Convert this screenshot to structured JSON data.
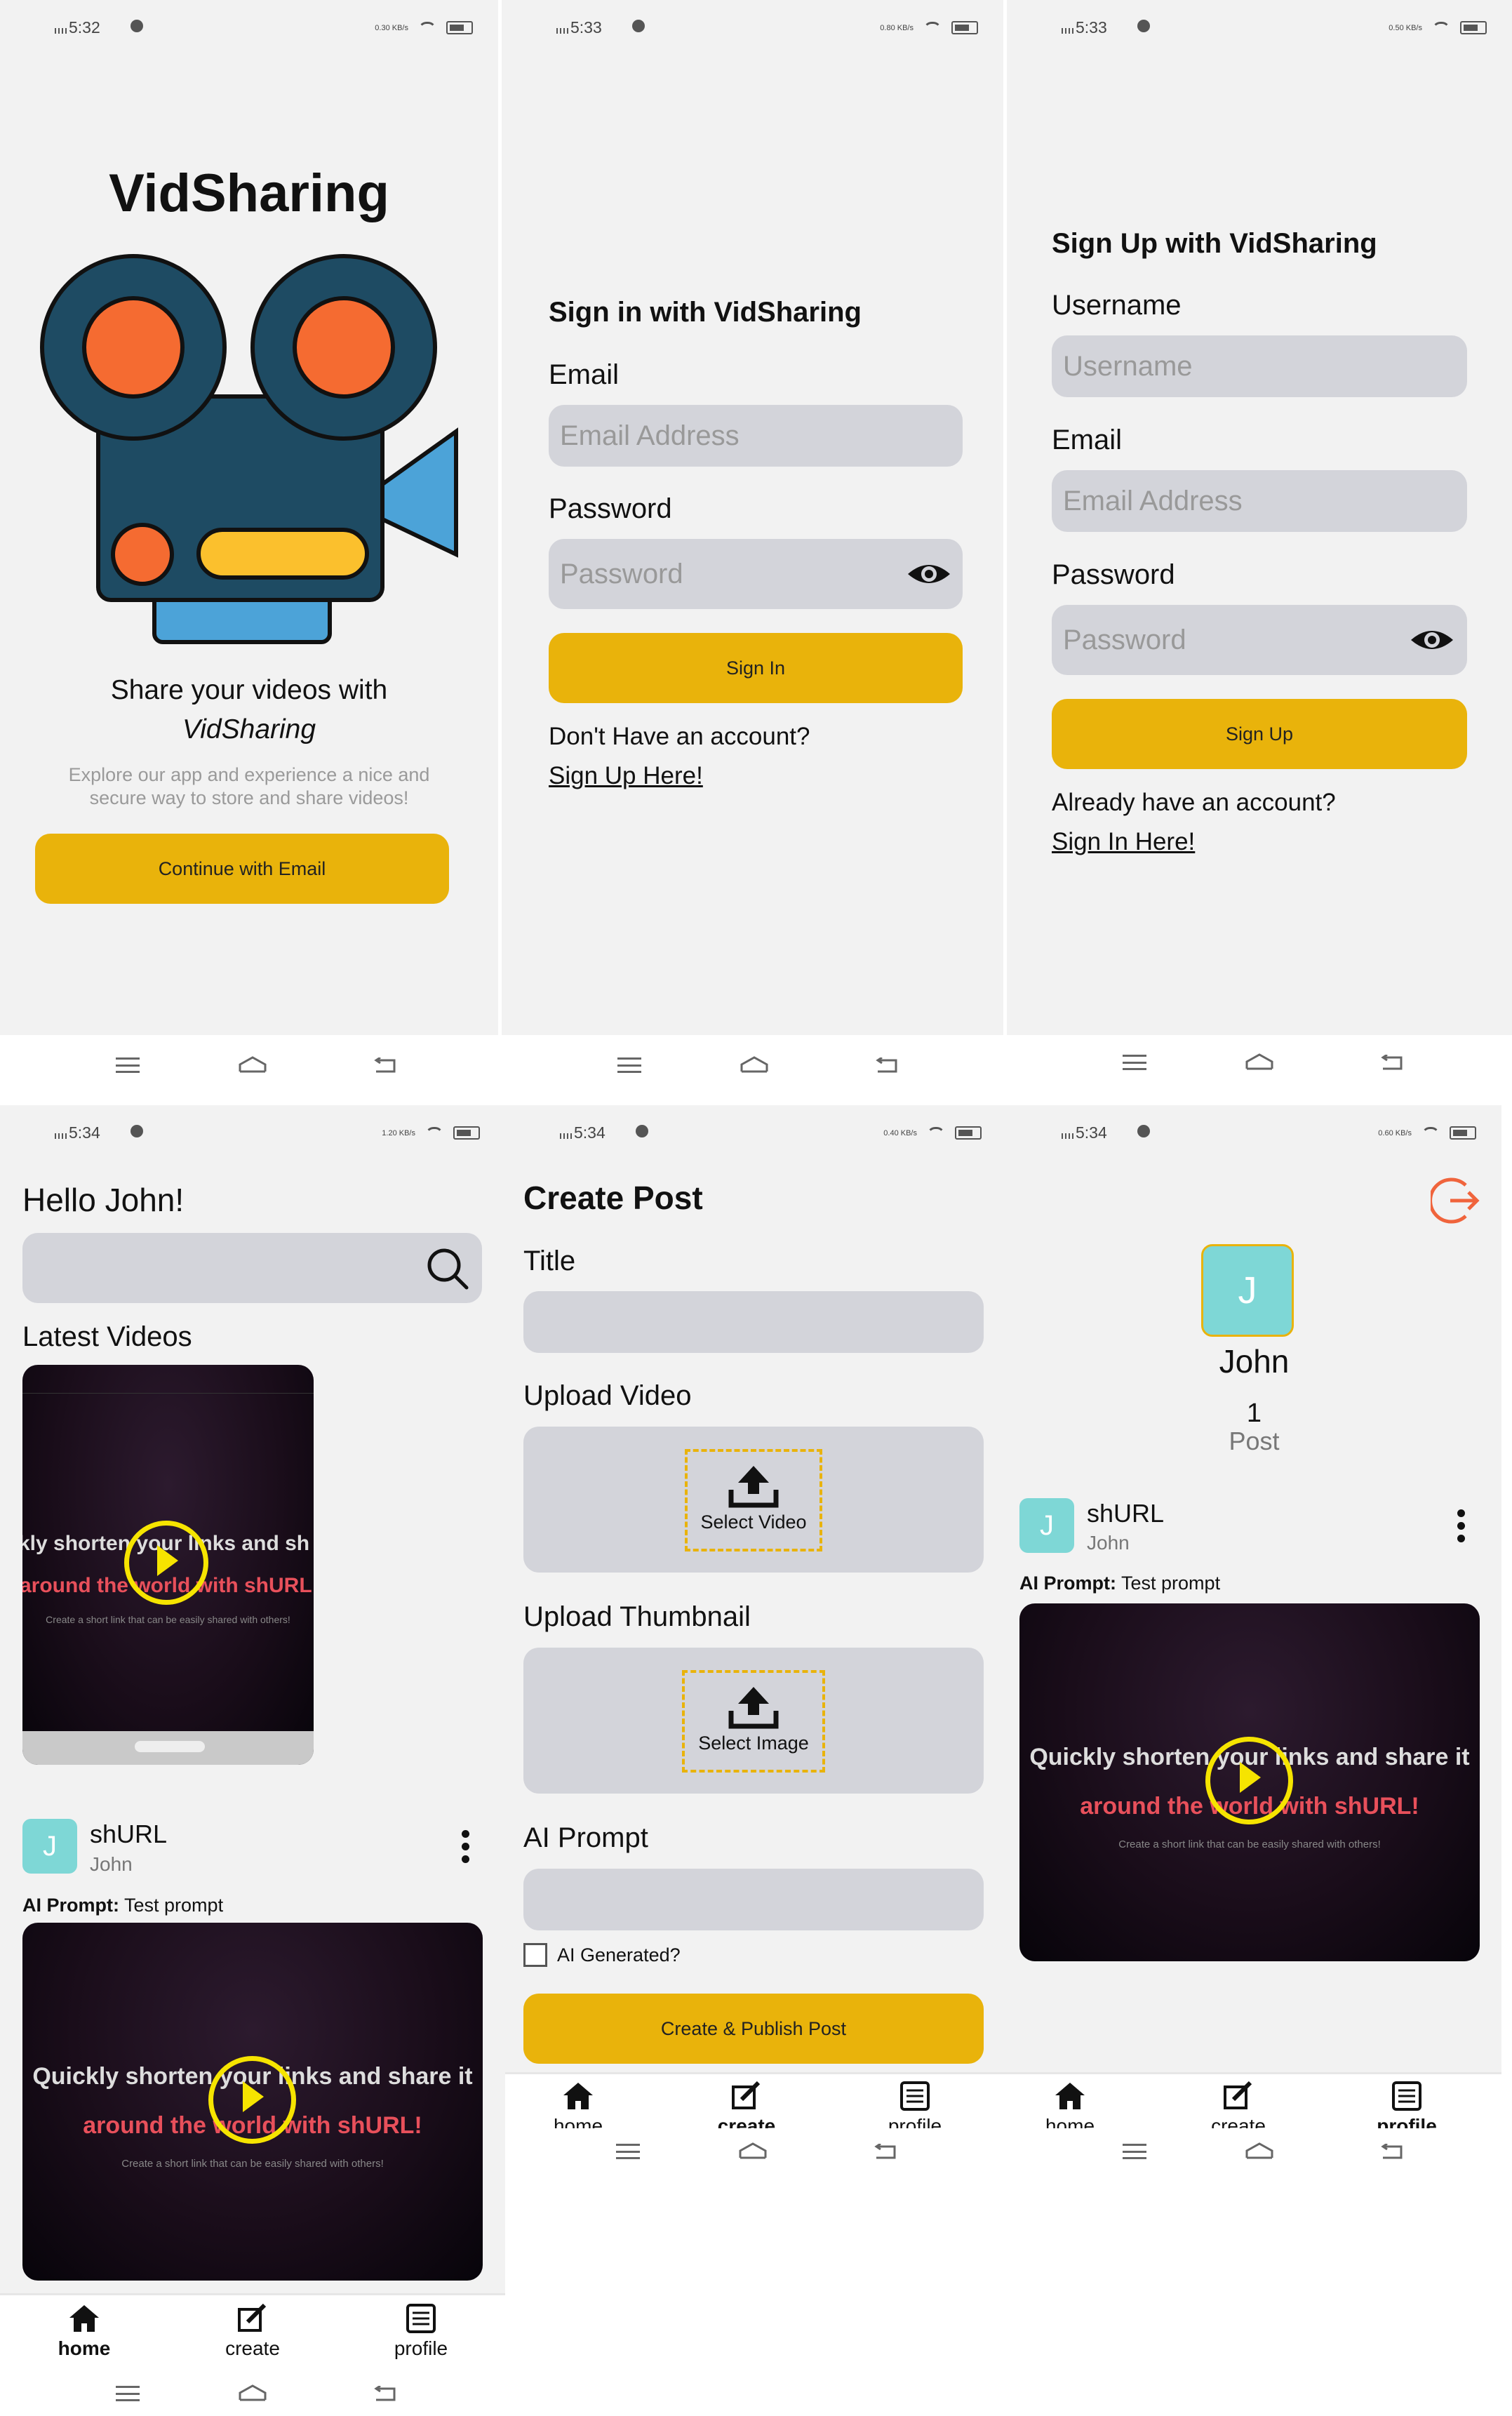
{
  "status": {
    "s1": {
      "time": "5:32",
      "speed": "0.30 KB/s"
    },
    "s2": {
      "time": "5:33",
      "speed": "0.80 KB/s"
    },
    "s3": {
      "time": "5:33",
      "speed": "0.50 KB/s"
    },
    "s4": {
      "time": "5:34",
      "speed": "1.20 KB/s"
    },
    "s5": {
      "time": "5:34",
      "speed": "0.40 KB/s"
    },
    "s6": {
      "time": "5:34",
      "speed": "0.60 KB/s"
    }
  },
  "welcome": {
    "app_title": "VidSharing",
    "tagline_1": "Share your videos with",
    "tagline_2": "VidSharing",
    "description": "Explore our app and experience a nice and secure way to store and share videos!",
    "cta": "Continue with Email"
  },
  "signin": {
    "title": "Sign in with VidSharing",
    "email_label": "Email",
    "email_placeholder": "Email Address",
    "password_label": "Password",
    "password_placeholder": "Password",
    "button": "Sign In",
    "prompt": "Don't Have an account?",
    "link": "Sign Up Here!"
  },
  "signup": {
    "title": "Sign Up with VidSharing",
    "username_label": "Username",
    "username_placeholder": "Username",
    "email_label": "Email",
    "email_placeholder": "Email Address",
    "password_label": "Password",
    "password_placeholder": "Password",
    "button": "Sign Up",
    "prompt": "Already have an account?",
    "link": "Sign In Here!"
  },
  "home": {
    "greeting": "Hello John!",
    "section": "Latest Videos",
    "thumb_line1": "kly shorten your links and sh",
    "thumb_line2": "around the world with shURL",
    "thumb_line3": "Create a short link that can be easily shared with others!",
    "post": {
      "avatar": "J",
      "title": "shURL",
      "author": "John",
      "prompt_label": "AI Prompt:",
      "prompt": "Test prompt",
      "line1": "Quickly shorten your links and share it",
      "line2": "around the world with shURL!",
      "line3": "Create a short link that can be easily shared with others!"
    }
  },
  "create": {
    "title": "Create Post",
    "title_label": "Title",
    "video_label": "Upload Video",
    "video_button": "Select Video",
    "thumb_label": "Upload Thumbnail",
    "thumb_button": "Select Image",
    "prompt_label": "AI Prompt",
    "checkbox": "AI Generated?",
    "submit": "Create & Publish Post"
  },
  "profile": {
    "avatar": "J",
    "name": "John",
    "post_count": "1",
    "post_label": "Post",
    "post": {
      "avatar": "J",
      "title": "shURL",
      "author": "John",
      "prompt_label": "AI Prompt:",
      "prompt": "Test prompt",
      "line1": "Quickly shorten your links and share it",
      "line2": "around the world with shURL!",
      "line3": "Create a short link that can be easily shared with others!"
    }
  },
  "tabs": {
    "home": "home",
    "create": "create",
    "profile": "profile"
  },
  "colors": {
    "accent": "#e9b30b",
    "avatar": "#7ed7d6",
    "logout": "#f0643c",
    "input": "#d3d4da"
  }
}
